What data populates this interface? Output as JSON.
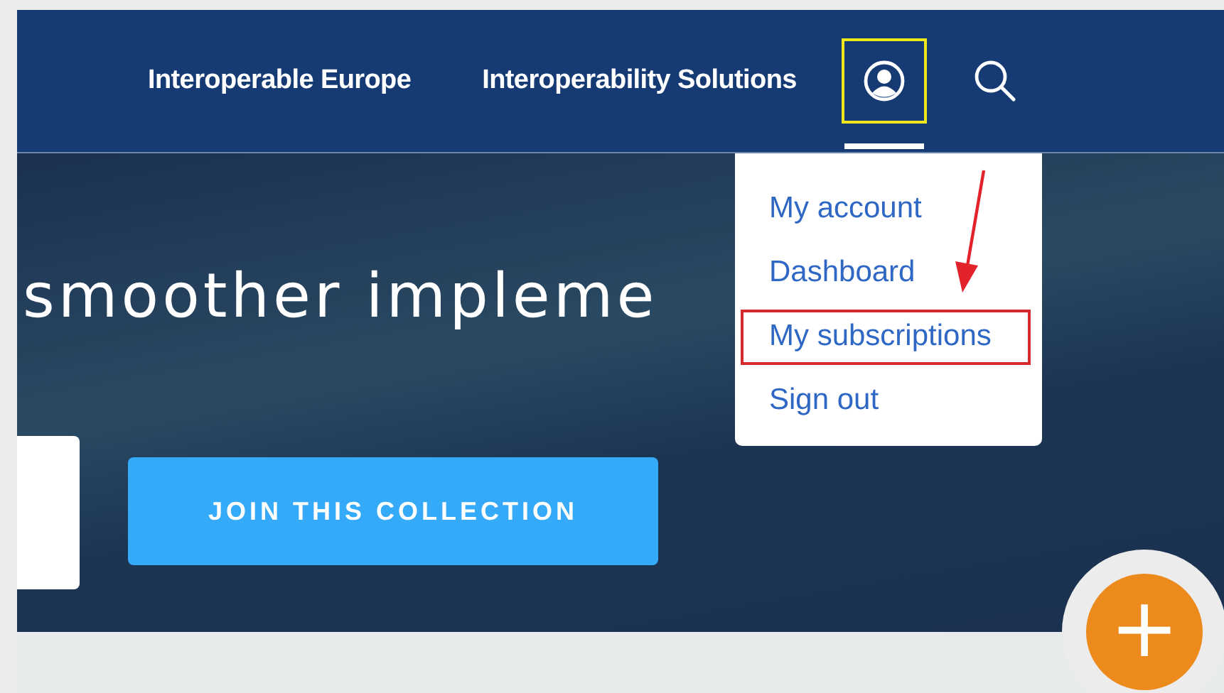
{
  "nav": {
    "links": [
      {
        "label": "Interoperable Europe"
      },
      {
        "label": "Interoperability Solutions"
      }
    ],
    "account_button": {
      "highlighted": true,
      "expanded": true
    }
  },
  "hero": {
    "title": "smoother impleme",
    "button": "JOIN THIS COLLECTION"
  },
  "account_menu": {
    "items": [
      {
        "label": "My account",
        "highlighted": false
      },
      {
        "label": "Dashboard",
        "highlighted": false
      },
      {
        "label": "My subscriptions",
        "highlighted": true
      },
      {
        "label": "Sign out",
        "highlighted": false
      }
    ]
  },
  "fab": {
    "label": "+"
  }
}
